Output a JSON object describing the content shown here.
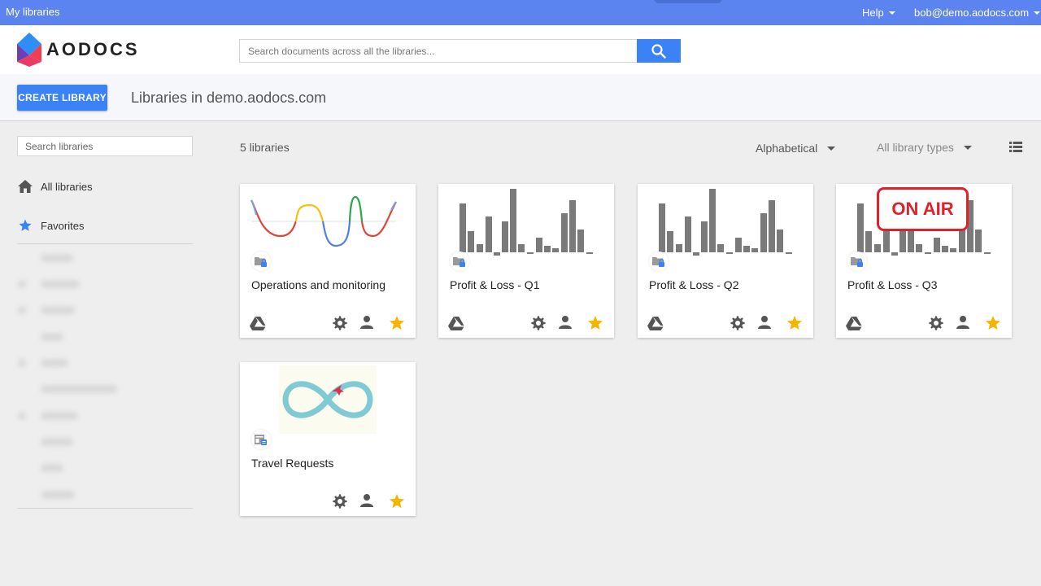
{
  "topbar": {
    "app_link": "My libraries",
    "help": "Help",
    "user_email": "bob@demo.aodocs.com"
  },
  "header": {
    "logo_text": "AODOCS",
    "search_placeholder": "Search documents across all the libraries..."
  },
  "subheader": {
    "create_button": "CREATE LIBRARY",
    "title": "Libraries in demo.aodocs.com"
  },
  "sidebar": {
    "search_placeholder": "Search libraries",
    "items": [
      {
        "label": "All libraries",
        "icon": "home-icon"
      },
      {
        "label": "Favorites",
        "icon": "star-icon"
      }
    ]
  },
  "toolbar": {
    "count": "5 libraries",
    "sort": "Alphabetical",
    "filter": "All library types",
    "view_icon": "list-view-icon"
  },
  "libraries": [
    {
      "name": "Operations and monitoring",
      "thumb": "waves",
      "favorite": true
    },
    {
      "name": "Profit & Loss - Q1",
      "thumb": "bars",
      "favorite": true
    },
    {
      "name": "Profit & Loss - Q2",
      "thumb": "bars",
      "favorite": true
    },
    {
      "name": "Profit & Loss - Q3",
      "thumb": "bars",
      "favorite": true
    },
    {
      "name": "Travel Requests",
      "thumb": "infinity",
      "favorite": true
    }
  ],
  "overlay": {
    "label": "ON AIR"
  },
  "colors": {
    "topbar": "#5b84f1",
    "primary": "#3b82f6",
    "star": "#f4b400",
    "on_air": "#e0202a"
  }
}
